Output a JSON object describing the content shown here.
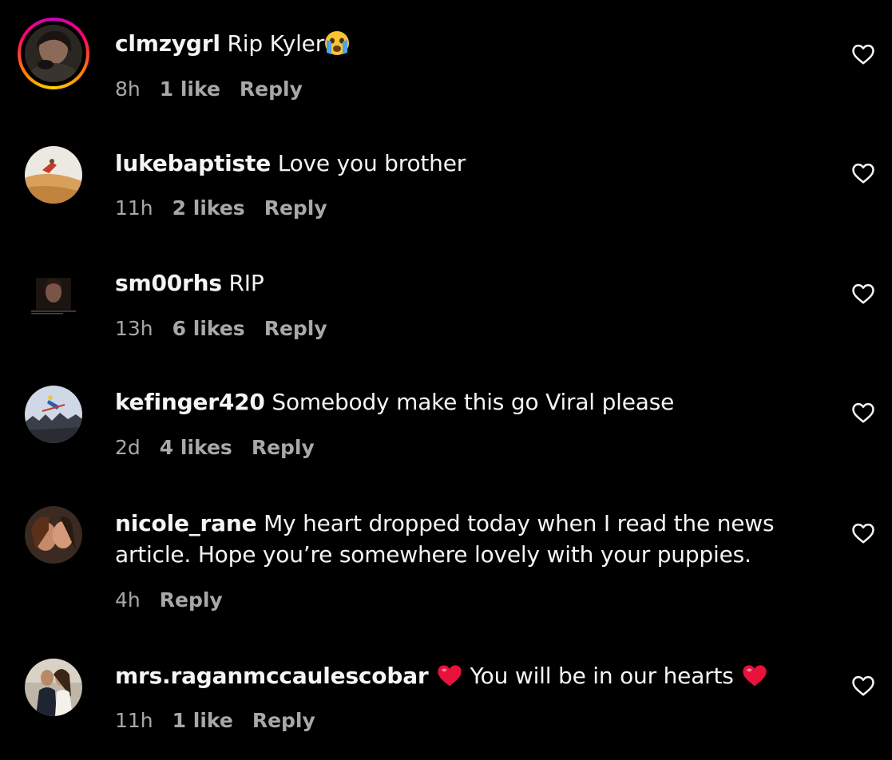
{
  "colors": {
    "background": "#000000",
    "text": "#f5f5f5",
    "meta": "#a8a8a8",
    "emoji_heart": "#e8123c"
  },
  "comments": [
    {
      "username": "clmzygrl",
      "text": "Rip Kyler",
      "emoji": "crying-face-icon",
      "age": "8h",
      "likes": "1 like",
      "reply": "Reply",
      "story_ring": true
    },
    {
      "username": "lukebaptiste",
      "text": "Love you brother",
      "age": "11h",
      "likes": "2 likes",
      "reply": "Reply"
    },
    {
      "username": "sm00rhs",
      "text": "RIP",
      "age": "13h",
      "likes": "6 likes",
      "reply": "Reply"
    },
    {
      "username": "kefinger420",
      "text": "Somebody make this go Viral please",
      "age": "2d",
      "likes": "4 likes",
      "reply": "Reply"
    },
    {
      "username": "nicole_rane",
      "text_line1": "My heart dropped today when I read the news",
      "text_line2": "article. Hope you’re somewhere lovely with your puppies.",
      "age": "4h",
      "reply": "Reply"
    },
    {
      "username": "mrs.raganmccaulescobar",
      "text": "You will be in our hearts",
      "emoji": "red-heart-icon",
      "age": "11h",
      "likes": "1 like",
      "reply": "Reply"
    }
  ]
}
